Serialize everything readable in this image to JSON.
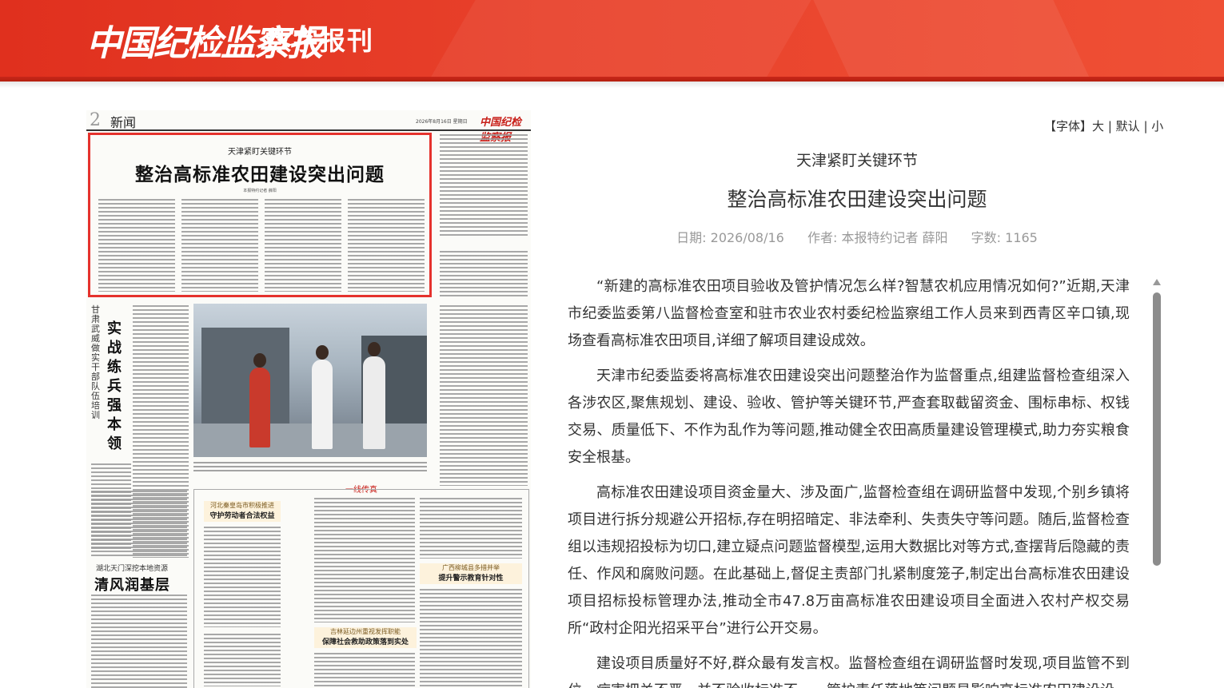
{
  "header": {
    "logo": "中国纪检监察报",
    "subtitle": "数字报刊"
  },
  "newspaper": {
    "page_number": "2",
    "section": "新闻",
    "date": "2026年8月16日 星期日",
    "masthead": "中国纪检监察报",
    "featured": {
      "subtitle": "天津紧盯关键环节",
      "title": "整治高标准农田建设突出问题",
      "byline": "本报特约记者 薛阳"
    },
    "vertical_subtitle": "甘肃武威做实干部队伍培训",
    "vertical_title": "实战练兵强本领",
    "column_tag": "一线传真",
    "box1": {
      "kicker": "河北秦皇岛市积极推进",
      "title": "守护劳动者合法权益"
    },
    "box2": {
      "kicker": "广西柳城县多措并举",
      "title": "提升警示教育针对性"
    },
    "box3": {
      "kicker": "吉林延边州重视发挥职能",
      "title": "保障社会救助政策落到实处"
    },
    "lower_subtitle": "湖北天门深挖本地资源",
    "lower_title": "清风润基层"
  },
  "font_control": {
    "label": "【字体】",
    "large": "大",
    "default": "默认",
    "small": "小",
    "separator": "|"
  },
  "article": {
    "subtitle": "天津紧盯关键环节",
    "title": "整治高标准农田建设突出问题",
    "date_label": "日期:",
    "date": "2026/08/16",
    "author_label": "作者:",
    "author": "本报特约记者 薛阳",
    "words_label": "字数:",
    "words": "1165",
    "paragraphs": [
      "“新建的高标准农田项目验收及管护情况怎么样?智慧农机应用情况如何?”近期,天津市纪委监委第八监督检查室和驻市农业农村委纪检监察组工作人员来到西青区辛口镇,现场查看高标准农田项目,详细了解项目建设成效。",
      "天津市纪委监委将高标准农田建设突出问题整治作为监督重点,组建监督检查组深入各涉农区,聚焦规划、建设、验收、管护等关键环节,严查套取截留资金、围标串标、权钱交易、质量低下、不作为乱作为等问题,推动健全农田高质量建设管理模式,助力夯实粮食安全根基。",
      "高标准农田建设项目资金量大、涉及面广,监督检查组在调研监督中发现,个别乡镇将项目进行拆分规避公开招标,存在明招暗定、非法牵利、失责失守等问题。随后,监督检查组以违规招投标为切口,建立疑点问题监督模型,运用大数据比对等方式,查摆背后隐藏的责任、作风和腐败问题。在此基础上,督促主责部门扎紧制度笼子,制定出台高标准农田建设项目招标投标管理办法,推动全市47.8万亩高标准农田建设项目全面进入农村产权交易所“政村企阳光招采平台”进行公开交易。",
      "建设项目质量好不好,群众最有发言权。监督检查组在调研监督时发现,项目监管不到位、病害把关不严、并不验收标准不一、管护责任落地等问题易影响高标准农田建设设"
    ]
  }
}
